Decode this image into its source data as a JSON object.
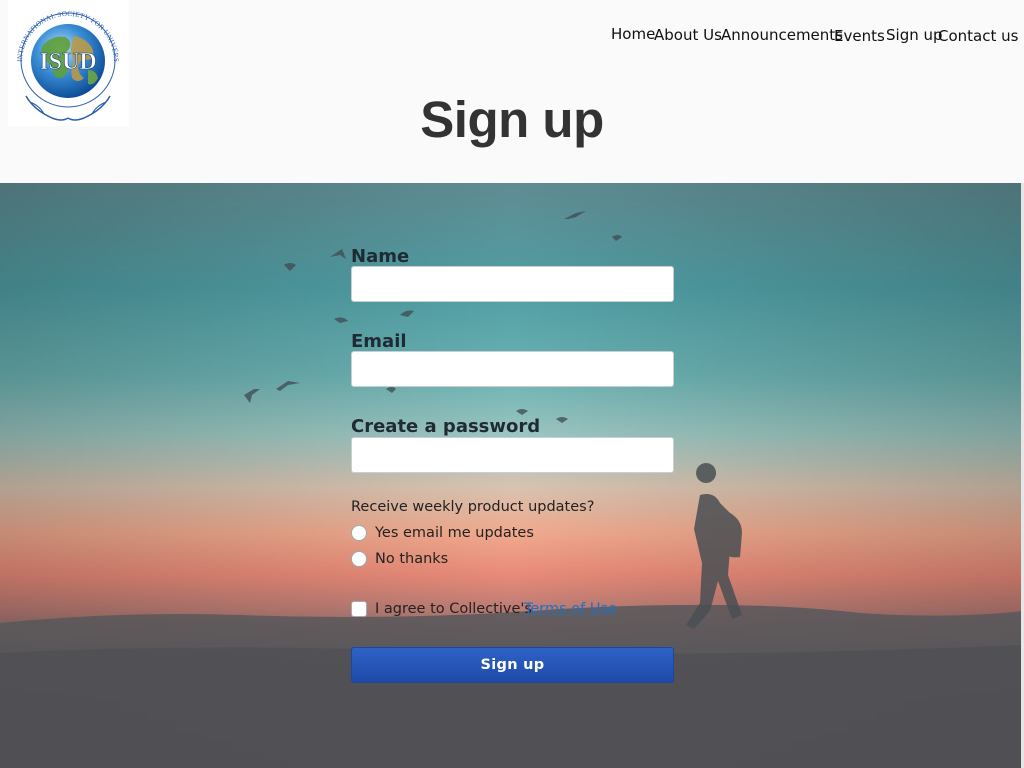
{
  "logo": {
    "text": "ISUD",
    "ring_text": "INTERNATIONAL SOCIETY FOR UNIVERSAL DIALOGUE"
  },
  "nav": {
    "items": [
      "Home",
      "About Us",
      "Announcements",
      "Events",
      "Sign up",
      "Contact us"
    ]
  },
  "page": {
    "title": "Sign up"
  },
  "form": {
    "name_label": "Name",
    "name_value": "",
    "email_label": "Email",
    "email_value": "",
    "password_label": "Create a password",
    "password_value": "",
    "updates_question": "Receive weekly product updates?",
    "updates_options": [
      "Yes email me updates",
      "No thanks"
    ],
    "updates_selected": null,
    "terms_prefix": "I agree to Collective's",
    "terms_link": "Terms of Use",
    "terms_checked": false,
    "submit_label": "Sign up"
  },
  "colors": {
    "page_background": "#fafafa",
    "title": "#333333",
    "button": "#2456b8",
    "link": "#1a73c7",
    "sky_top": "#4f9ea4",
    "sky_sunset": "#f0a98d",
    "ground": "#555558"
  },
  "icons": {
    "logo": "globe-with-hands-logo"
  }
}
